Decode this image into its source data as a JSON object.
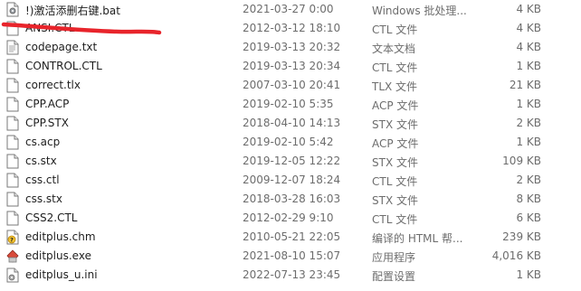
{
  "files": [
    {
      "name": "!)激活添删右键.bat",
      "date": "2021-03-27 0:00",
      "type": "Windows 批处理...",
      "size": "4 KB",
      "icon": "gear-doc-icon"
    },
    {
      "name": "ANSI.CTL",
      "date": "2012-03-12 18:10",
      "type": "CTL 文件",
      "size": "4 KB",
      "icon": "blank-doc-icon"
    },
    {
      "name": "codepage.txt",
      "date": "2019-03-13 20:32",
      "type": "文本文档",
      "size": "4 KB",
      "icon": "text-doc-icon"
    },
    {
      "name": "CONTROL.CTL",
      "date": "2019-03-13 20:34",
      "type": "CTL 文件",
      "size": "1 KB",
      "icon": "blank-doc-icon"
    },
    {
      "name": "correct.tlx",
      "date": "2007-03-10 20:41",
      "type": "TLX 文件",
      "size": "21 KB",
      "icon": "blank-doc-icon"
    },
    {
      "name": "CPP.ACP",
      "date": "2019-02-10 5:35",
      "type": "ACP 文件",
      "size": "1 KB",
      "icon": "blank-doc-icon"
    },
    {
      "name": "CPP.STX",
      "date": "2018-04-10 14:13",
      "type": "STX 文件",
      "size": "2 KB",
      "icon": "blank-doc-icon"
    },
    {
      "name": "cs.acp",
      "date": "2019-02-10 5:42",
      "type": "ACP 文件",
      "size": "1 KB",
      "icon": "blank-doc-icon"
    },
    {
      "name": "cs.stx",
      "date": "2019-12-05 12:22",
      "type": "STX 文件",
      "size": "109 KB",
      "icon": "blank-doc-icon"
    },
    {
      "name": "css.ctl",
      "date": "2009-12-07 18:24",
      "type": "CTL 文件",
      "size": "2 KB",
      "icon": "blank-doc-icon"
    },
    {
      "name": "css.stx",
      "date": "2018-03-28 16:03",
      "type": "STX 文件",
      "size": "8 KB",
      "icon": "blank-doc-icon"
    },
    {
      "name": "CSS2.CTL",
      "date": "2012-02-29 9:10",
      "type": "CTL 文件",
      "size": "6 KB",
      "icon": "blank-doc-icon"
    },
    {
      "name": "editplus.chm",
      "date": "2010-05-21 22:05",
      "type": "编译的 HTML 帮...",
      "size": "239 KB",
      "icon": "help-doc-icon"
    },
    {
      "name": "editplus.exe",
      "date": "2021-08-10 15:07",
      "type": "应用程序",
      "size": "4,016 KB",
      "icon": "app-icon"
    },
    {
      "name": "editplus_u.ini",
      "date": "2022-07-13 23:45",
      "type": "配置设置",
      "size": "1 KB",
      "icon": "settings-doc-icon"
    }
  ],
  "colors": {
    "annotation_red": "#e8242b",
    "meta_text": "#6d6d6d"
  }
}
